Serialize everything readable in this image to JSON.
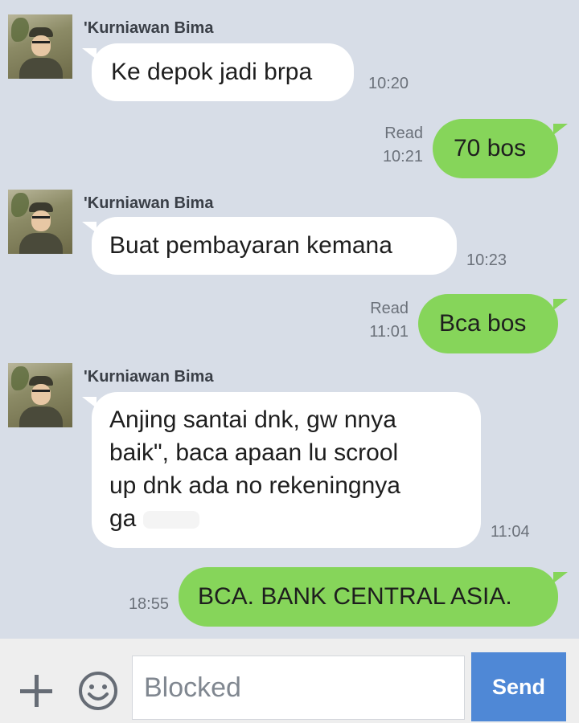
{
  "messages": [
    {
      "type": "in",
      "sender": "'Kurniawan Bima",
      "text": "Ke depok jadi brpa",
      "time": "10:20"
    },
    {
      "type": "out",
      "status": "Read",
      "text": "70 bos",
      "time": "10:21"
    },
    {
      "type": "in",
      "sender": "'Kurniawan Bima",
      "text": "Buat pembayaran kemana",
      "time": "10:23"
    },
    {
      "type": "out",
      "status": "Read",
      "text": "Bca bos",
      "time": "11:01"
    },
    {
      "type": "in",
      "sender": "'Kurniawan Bima",
      "text_lines": [
        "Anjing santai dnk, gw nnya",
        "baik\", baca apaan lu scrool",
        "up dnk ada no rekeningnya",
        "ga"
      ],
      "time": "11:04"
    },
    {
      "type": "out",
      "text": "BCA. BANK CENTRAL ASIA.",
      "time": "18:55"
    }
  ],
  "input_bar": {
    "add_icon": "plus-icon",
    "emoji_icon": "smiley-icon",
    "field_text": "Blocked",
    "send_label": "Send"
  },
  "colors": {
    "chat_background": "#d7dde7",
    "incoming_bubble": "#ffffff",
    "outgoing_bubble": "#86d55a",
    "send_button": "#4f88d6"
  }
}
